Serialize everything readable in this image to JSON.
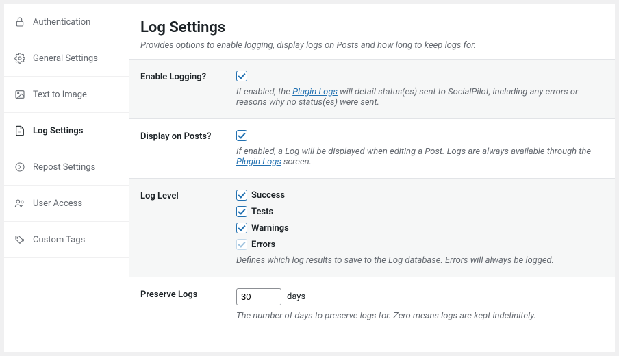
{
  "sidebar": {
    "items": [
      {
        "label": "Authentication"
      },
      {
        "label": "General Settings"
      },
      {
        "label": "Text to Image"
      },
      {
        "label": "Log Settings"
      },
      {
        "label": "Repost Settings"
      },
      {
        "label": "User Access"
      },
      {
        "label": "Custom Tags"
      }
    ]
  },
  "header": {
    "title": "Log Settings",
    "desc": "Provides options to enable logging, display logs on Posts and how long to keep logs for."
  },
  "enable": {
    "label": "Enable Logging?",
    "checked": true,
    "help_pre": "If enabled, the ",
    "help_link": "Plugin Logs",
    "help_post": " will detail status(es) sent to SocialPilot, including any errors or reasons why no status(es) were sent."
  },
  "display": {
    "label": "Display on Posts?",
    "checked": true,
    "help_pre": "If enabled, a Log will be displayed when editing a Post. Logs are always available through the ",
    "help_link": "Plugin Logs",
    "help_post": " screen."
  },
  "loglevel": {
    "label": "Log Level",
    "options": [
      {
        "label": "Success",
        "checked": true,
        "mandatory": false
      },
      {
        "label": "Tests",
        "checked": true,
        "mandatory": false
      },
      {
        "label": "Warnings",
        "checked": true,
        "mandatory": false
      },
      {
        "label": "Errors",
        "checked": true,
        "mandatory": true
      }
    ],
    "help": "Defines which log results to save to the Log database. Errors will always be logged."
  },
  "preserve": {
    "label": "Preserve Logs",
    "value": "30",
    "unit": "days",
    "help": "The number of days to preserve logs for. Zero means logs are kept indefinitely."
  }
}
